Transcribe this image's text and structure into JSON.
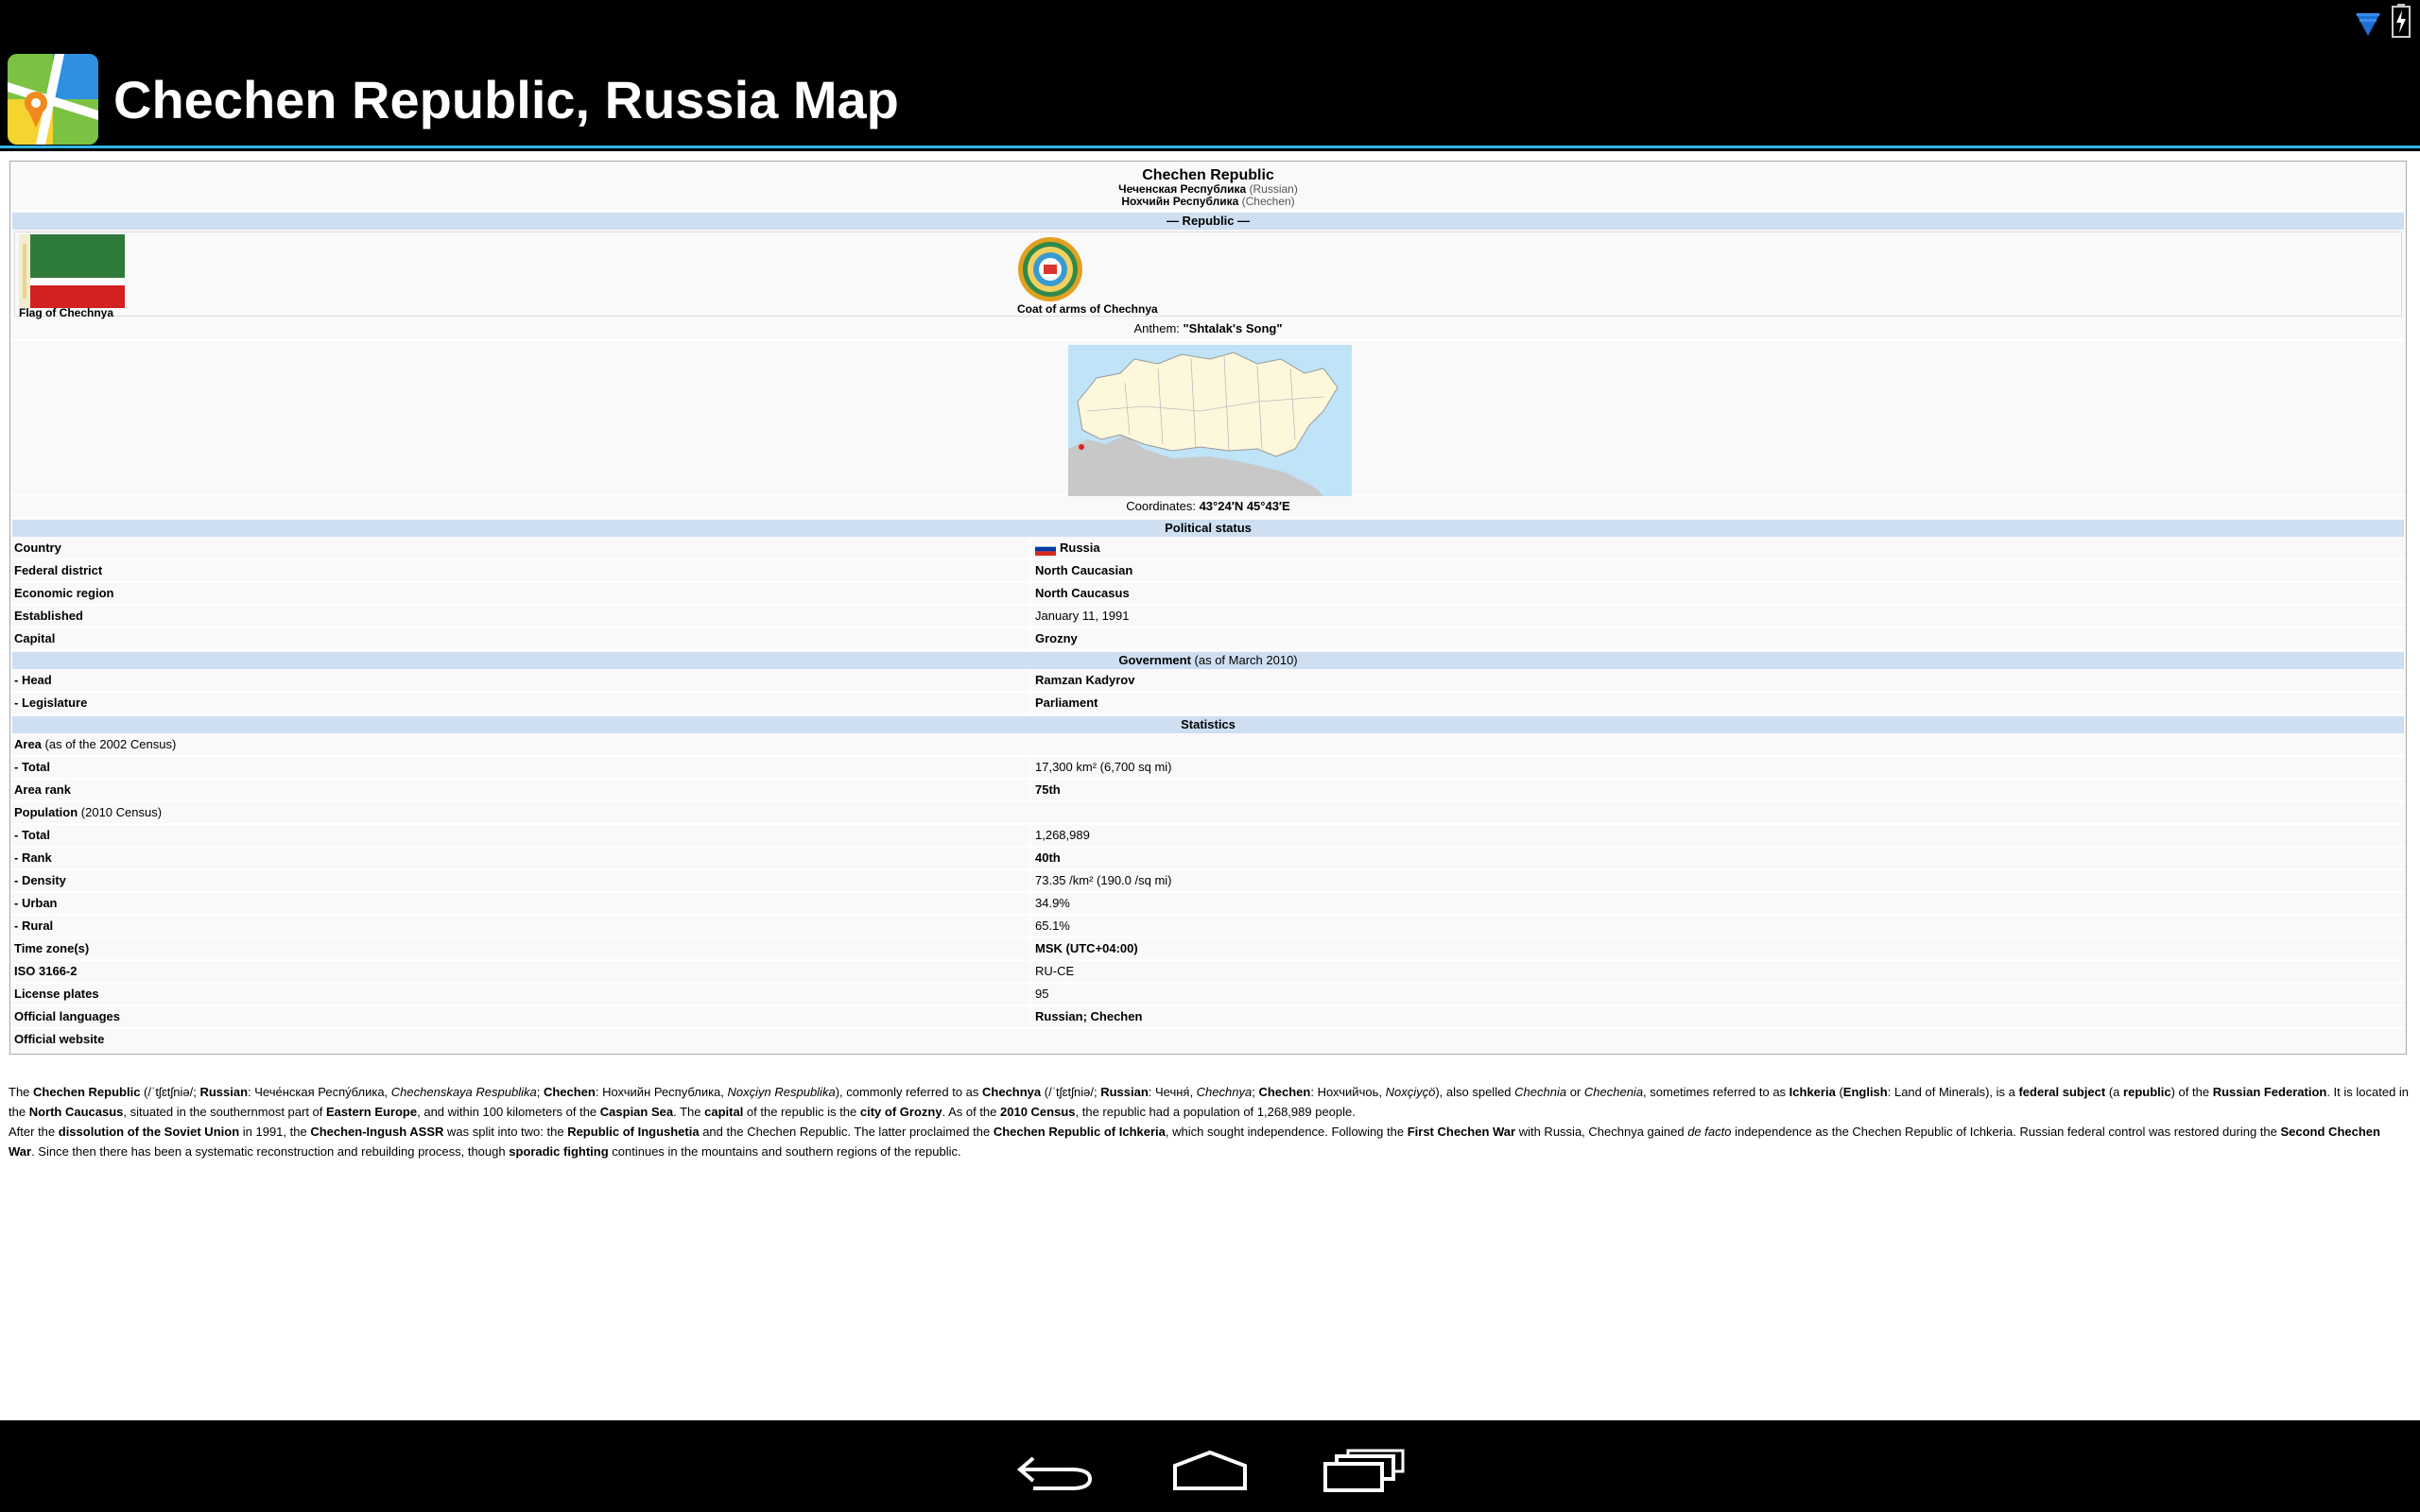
{
  "header": {
    "title": "Chechen Republic, Russia Map"
  },
  "status": {
    "icons": [
      "wifi-icon",
      "battery-icon"
    ]
  },
  "infobox": {
    "name": "Chechen Republic",
    "name_ru": "Чеченская Республика",
    "name_ru_lang": "(Russian)",
    "name_ce": "Нохчийн Республика",
    "name_ce_lang": "(Chechen)",
    "type_header": "— Republic —",
    "flag_caption": "Flag of Chechnya",
    "coat_caption": "Coat of arms of Chechnya",
    "anthem_label": "Anthem: ",
    "anthem_value": "\"Shtalak's Song\"",
    "coordinates_label": "Coordinates: ",
    "coordinates_value": "43°24′N 45°43′E",
    "political_header": "Political status",
    "political_rows": [
      {
        "label": "Country",
        "value": "Russia"
      },
      {
        "label": "Federal district",
        "value": "North Caucasian"
      },
      {
        "label": "Economic region",
        "value": "North Caucasus"
      },
      {
        "label": "Established",
        "value": "January 11, 1991"
      },
      {
        "label": "Capital",
        "value": "Grozny"
      }
    ],
    "government_header": "Government",
    "government_header_note": " (as of March 2010)",
    "government_rows": [
      {
        "label": " - Head",
        "value": "Ramzan Kadyrov"
      },
      {
        "label": " - Legislature",
        "value": "Parliament"
      }
    ],
    "statistics_header": "Statistics",
    "area_label": "Area",
    "area_note": " (as of the 2002 Census)",
    "area_total_label": " - Total",
    "area_total_value": "17,300 km² (6,700 sq mi)",
    "area_rank_label": "Area rank",
    "area_rank_value": "75th",
    "population_label": "Population",
    "population_note": " (2010 Census)",
    "population_rows": [
      {
        "label": " - Total",
        "value": "1,268,989"
      },
      {
        "label": " - Rank",
        "value": "40th"
      },
      {
        "label": " - Density",
        "value": "73.35 /km² (190.0 /sq mi)"
      },
      {
        "label": " - Urban",
        "value": "34.9%"
      },
      {
        "label": " - Rural",
        "value": "65.1%"
      }
    ],
    "misc_rows": [
      {
        "label": "Time zone(s)",
        "value": "MSK (UTC+04:00)"
      },
      {
        "label": "ISO 3166-2",
        "value": "RU-CE"
      },
      {
        "label": "License plates",
        "value": "95"
      },
      {
        "label": "Official languages",
        "value": "Russian; Chechen"
      },
      {
        "label": "Official website",
        "value": ""
      }
    ]
  },
  "article": {
    "p1": {
      "t01": "The ",
      "b01": "Chechen Republic",
      "t02": " (/ˈtʃɛtʃniə/; ",
      "b02": "Russian",
      "t03": ": Чече́нская Респу́блика, ",
      "i01": "Chechenskaya Respublika",
      "t04": "; ",
      "b03": "Chechen",
      "t05": ": Нохчийн Республика, ",
      "i02": "Noxçiyn Respublika",
      "t06": "), commonly referred to as ",
      "b04": "Chechnya",
      "t07": " (/ˈtʃɛtʃniə/; ",
      "b05": "Russian",
      "t08": ": Чечня́, ",
      "i03": "Chechnya",
      "t09": "; ",
      "b06": "Chechen",
      "t10": ": Нохчийчоь, ",
      "i04": "Noxçiyçö",
      "t11": "), also spelled ",
      "i05": "Chechnia",
      "t12": " or ",
      "i06": "Chechenia",
      "t13": ", sometimes referred to as ",
      "b07": "Ichkeria",
      "t14": " (",
      "b08": "English",
      "t15": ": Land of Minerals), is a ",
      "b09": "federal subject",
      "t16": " (a ",
      "b10": "republic",
      "t17": ") of the ",
      "b11": "Russian Federation",
      "t18": ". It is located in the ",
      "b12": "North Caucasus",
      "t19": ", situated in the southernmost part of ",
      "b13": "Eastern Europe",
      "t20": ", and within 100 kilometers of the ",
      "b14": "Caspian Sea",
      "t21": ". The ",
      "b15": "capital",
      "t22": " of the republic is the ",
      "b16": "city of Grozny",
      "t23": ". As of the ",
      "b17": "2010 Census",
      "t24": ", the republic had a population of 1,268,989 people."
    },
    "p2": {
      "t01": "After the ",
      "b01": "dissolution of the Soviet Union",
      "t02": " in 1991, the ",
      "b02": "Chechen-Ingush ASSR",
      "t03": " was split into two: the ",
      "b03": "Republic of Ingushetia",
      "t04": " and the Chechen Republic. The latter proclaimed the ",
      "b04": "Chechen Republic of Ichkeria",
      "t05": ", which sought independence. Following the ",
      "b05": "First Chechen War",
      "t06": " with Russia, Chechnya gained ",
      "i01": "de facto",
      "t07": " independence as the Chechen Republic of Ichkeria. Russian federal control was restored during the ",
      "b06": "Second Chechen War",
      "t08": ". Since then there has been a systematic reconstruction and rebuilding process, though ",
      "b07": "sporadic fighting",
      "t09": " continues in the mountains and southern regions of the republic."
    }
  },
  "nav": {
    "buttons": [
      "back-icon",
      "home-icon",
      "recent-apps-icon"
    ]
  }
}
